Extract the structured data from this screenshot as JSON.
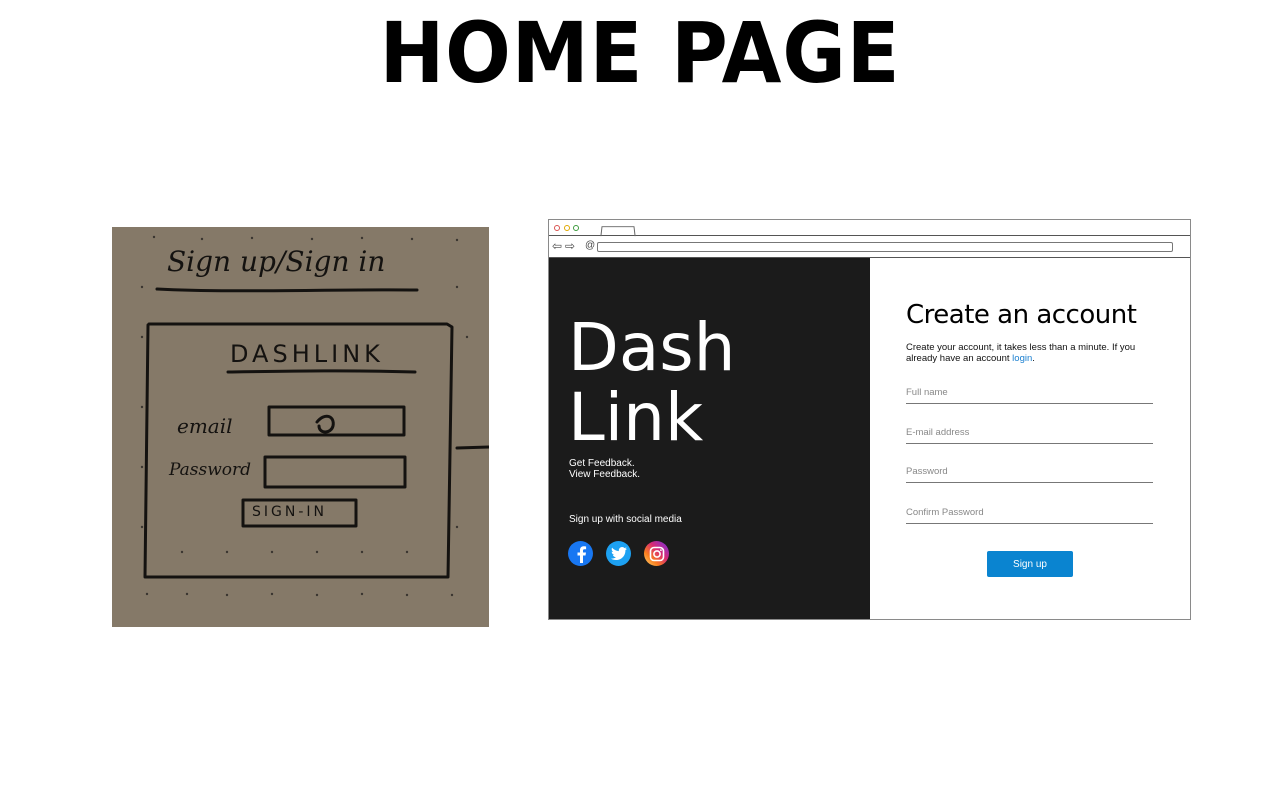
{
  "page": {
    "title": "HOME PAGE"
  },
  "sketch": {
    "heading": "Sign up/Sign in",
    "brand": "DASHLINK",
    "email_label": "email",
    "password_label": "Password",
    "button": "SIGN-IN"
  },
  "mockup": {
    "brand_line1": "Dash",
    "brand_line2": "Link",
    "tagline1": "Get Feedback.",
    "tagline2": "View Feedback.",
    "social_heading": "Sign up with social media",
    "social_icons": [
      "facebook-icon",
      "twitter-icon",
      "instagram-icon"
    ],
    "form": {
      "title": "Create an account",
      "subtitle": "Create your account, it takes less than a minute. If you already have an account",
      "login_link": "login",
      "fields": [
        {
          "placeholder": "Full name"
        },
        {
          "placeholder": "E-mail address"
        },
        {
          "placeholder": "Password"
        },
        {
          "placeholder": "Confirm Password"
        }
      ],
      "submit_label": "Sign up"
    }
  },
  "colors": {
    "dark_panel": "#1b1b1b",
    "accent": "#0a84d0",
    "link": "#1a7fd0",
    "facebook": "#1877f2",
    "twitter": "#1da1f2"
  }
}
